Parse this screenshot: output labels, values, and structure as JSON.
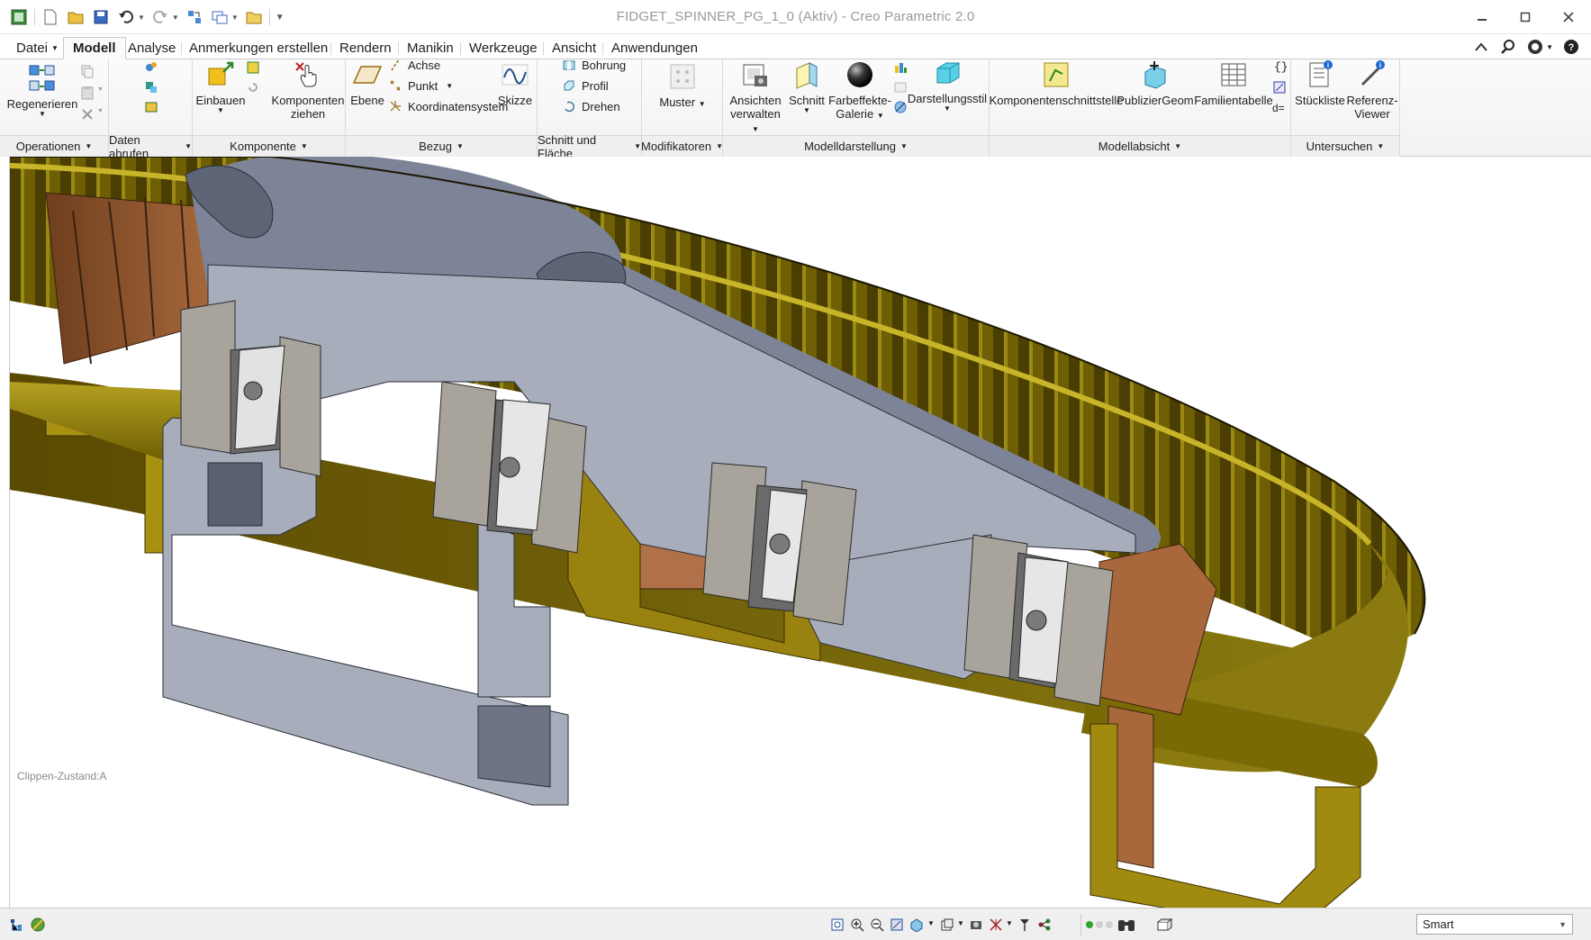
{
  "window": {
    "title": "FIDGET_SPINNER_PG_1_0 (Aktiv) - Creo Parametric 2.0"
  },
  "quick_access": {
    "icons": [
      "app-icon",
      "new-icon",
      "open-icon",
      "save-icon",
      "undo-icon",
      "redo-icon",
      "regenerate-icon",
      "windows-icon",
      "close-window-icon",
      "customize-icon"
    ]
  },
  "tabs": [
    {
      "label": "Datei",
      "has_dropdown": true
    },
    {
      "label": "Modell",
      "active": true
    },
    {
      "label": "Analyse"
    },
    {
      "label": "Anmerkungen erstellen"
    },
    {
      "label": "Rendern"
    },
    {
      "label": "Manikin"
    },
    {
      "label": "Werkzeuge"
    },
    {
      "label": "Ansicht"
    },
    {
      "label": "Anwendungen"
    }
  ],
  "ribbon": {
    "operationen": {
      "label": "Operationen",
      "regenerieren": "Regenerieren"
    },
    "daten_abrufen": {
      "label": "Daten abrufen"
    },
    "komponente": {
      "label": "Komponente",
      "einbauen": "Einbauen",
      "komponenten_ziehen_1": "Komponenten",
      "komponenten_ziehen_2": "ziehen"
    },
    "bezug": {
      "label": "Bezug",
      "ebene": "Ebene",
      "achse": "Achse",
      "punkt": "Punkt",
      "koordinatensystem": "Koordinatensystem",
      "skizze": "Skizze"
    },
    "schnitt_flaeche": {
      "label": "Schnitt und Fläche",
      "bohrung": "Bohrung",
      "profil": "Profil",
      "drehen": "Drehen"
    },
    "modifikatoren": {
      "label": "Modifikatoren",
      "muster": "Muster"
    },
    "modelldarstellung": {
      "label": "Modelldarstellung",
      "ansichten_1": "Ansichten",
      "ansichten_2": "verwalten",
      "schnitt": "Schnitt",
      "farbeffekte_1": "Farbeffekte-",
      "farbeffekte_2": "Galerie",
      "darstellungsstil": "Darstellungsstil"
    },
    "modellabsicht": {
      "label": "Modellabsicht",
      "komponentenschnittstelle": "Komponentenschnittstelle",
      "publiziergeom": "PublizierGeom",
      "familientabelle": "Familientabelle"
    },
    "untersuchen": {
      "label": "Untersuchen",
      "stueckliste": "Stückliste",
      "referenz_1": "Referenz-",
      "referenz_2": "Viewer"
    }
  },
  "viewport": {
    "clip_state": "Clippen-Zustand:A",
    "colors": {
      "outer_ring": "#7a6a08",
      "outer_ring_light": "#b09a18",
      "arm": "#a4a9b8",
      "arm_dark": "#6c7384",
      "bearing_outer": "#a8a49c",
      "bearing_inner": "#d8d8d8",
      "copper": "#a9683c",
      "copper_dark": "#6e3e1e"
    }
  },
  "statusbar": {
    "filter": "Smart"
  }
}
